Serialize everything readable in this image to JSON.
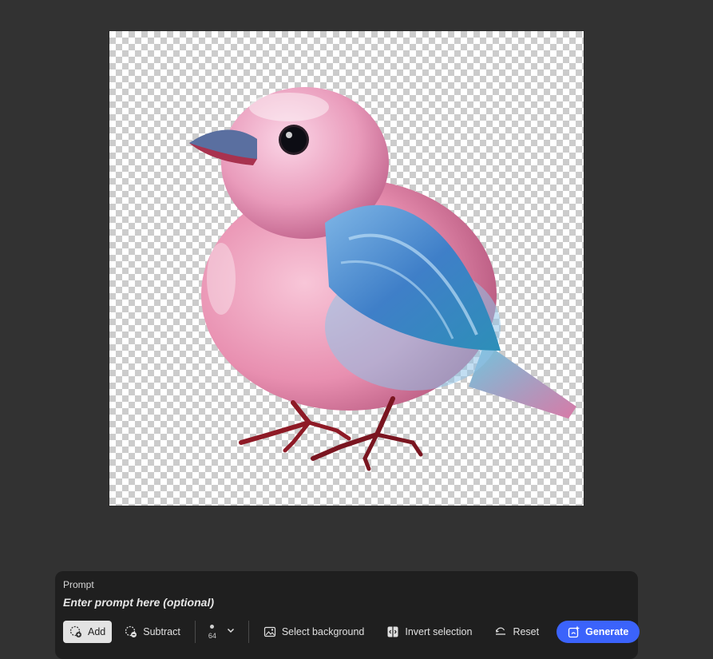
{
  "canvas": {
    "image": "pink-blue-glossy-bird-icon",
    "background": "transparent-checkerboard"
  },
  "prompt": {
    "label": "Prompt",
    "placeholder": "Enter prompt here (optional)"
  },
  "toolbar": {
    "add_label": "Add",
    "subtract_label": "Subtract",
    "brush_size": "64",
    "select_background_label": "Select background",
    "invert_selection_label": "Invert selection",
    "reset_label": "Reset",
    "generate_label": "Generate"
  },
  "colors": {
    "background": "#323232",
    "panel": "#1f1f1f",
    "accent": "#3b63fb",
    "active_tool": "#e3e3e3"
  }
}
